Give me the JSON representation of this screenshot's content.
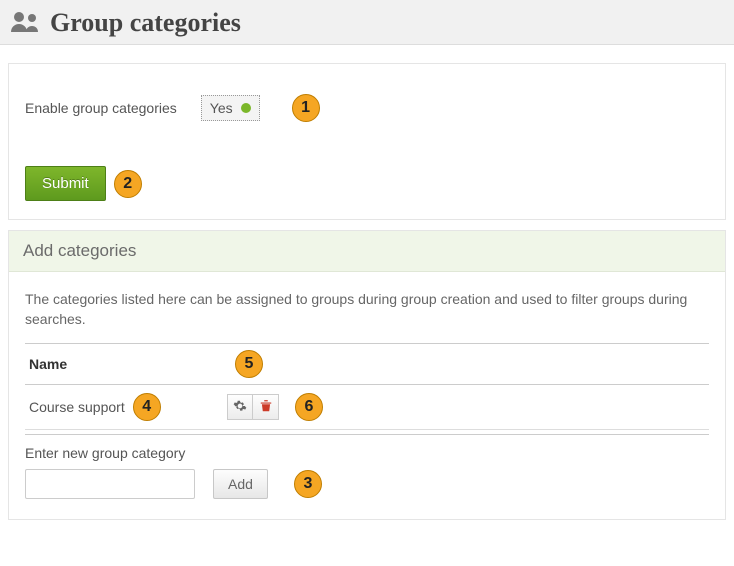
{
  "header": {
    "title": "Group categories",
    "icon": "group-icon"
  },
  "enable_panel": {
    "label": "Enable group categories",
    "toggle_text": "Yes",
    "toggle_state": "on",
    "submit_label": "Submit"
  },
  "add_section": {
    "title": "Add categories",
    "description": "The categories listed here can be assigned to groups during group creation and used to filter groups during searches.",
    "table": {
      "header_name": "Name",
      "rows": [
        {
          "name": "Course support"
        }
      ]
    },
    "enter_label": "Enter new group category",
    "add_button_label": "Add",
    "new_category_value": ""
  },
  "callouts": {
    "c1": "1",
    "c2": "2",
    "c3": "3",
    "c4": "4",
    "c5": "5",
    "c6": "6"
  },
  "colors": {
    "accent_green": "#6fa81e",
    "callout_orange": "#f5a623",
    "delete_red": "#cc3b28"
  }
}
